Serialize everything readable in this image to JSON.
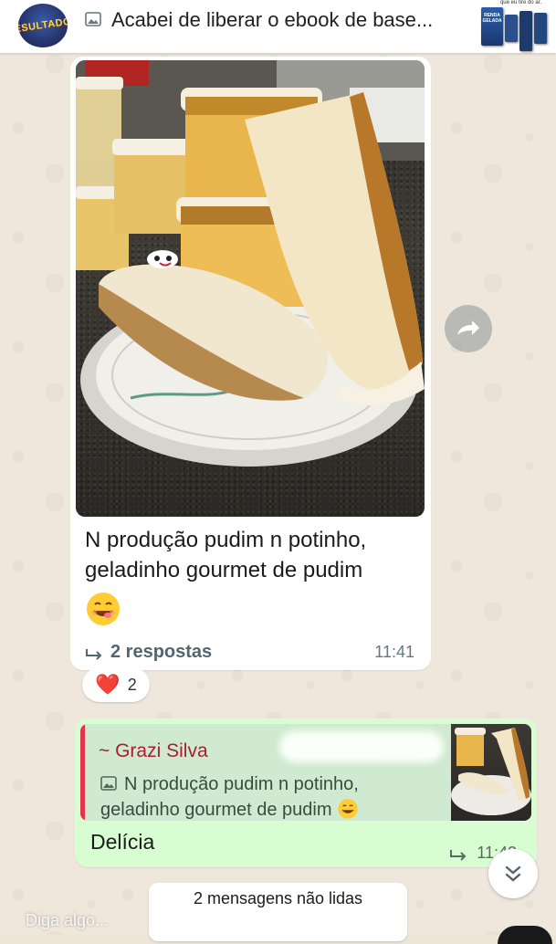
{
  "pinned": {
    "avatar_text": "RESULTADOS",
    "text": "Acabei de liberar o ebook de base...",
    "ebook_tagline": "que eu tire do ar.",
    "ebook_title": "RENDA GELADA"
  },
  "incoming": {
    "text_line1": "N produção pudim n potinho,",
    "text_line2": "geladinho gourmet de pudim",
    "emoji": "smiling-face-yum",
    "replies_label": "2 respostas",
    "time": "11:41",
    "reaction_emoji": "❤️",
    "reaction_count": "2"
  },
  "outgoing": {
    "quote_author": "~ Grazi Silva",
    "quote_phone_fragment": "2180",
    "quote_text": "N produção pudim n potinho, geladinho gourmet de pudim",
    "text": "Delícia",
    "time": "11:42"
  },
  "unread_label": "2 mensagens não lidas",
  "composer_placeholder": "Diga algo...",
  "colors": {
    "incoming_bubble": "#ffffff",
    "outgoing_bubble": "#d9fdd3",
    "quote_accent": "#e5344a",
    "author_color": "#a8202f"
  }
}
